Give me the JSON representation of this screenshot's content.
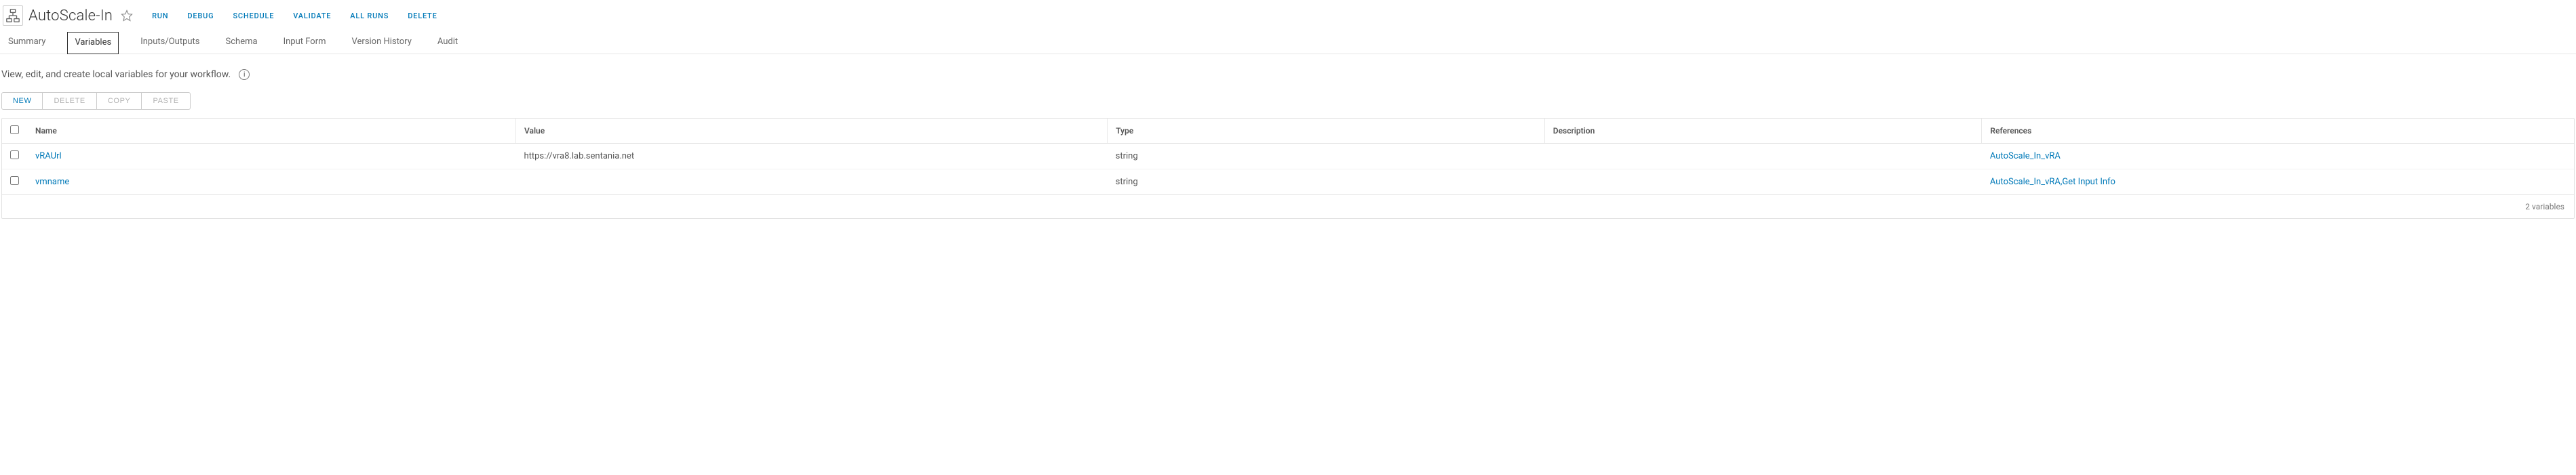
{
  "header": {
    "title": "AutoScale-In",
    "actions": {
      "run": "RUN",
      "debug": "DEBUG",
      "schedule": "SCHEDULE",
      "validate": "VALIDATE",
      "all_runs": "ALL RUNS",
      "delete": "DELETE"
    }
  },
  "tabs": {
    "summary": "Summary",
    "variables": "Variables",
    "inputs_outputs": "Inputs/Outputs",
    "schema": "Schema",
    "input_form": "Input Form",
    "version_history": "Version History",
    "audit": "Audit"
  },
  "description": "View, edit, and create local variables for your workflow.",
  "toolbar": {
    "new": "NEW",
    "delete": "DELETE",
    "copy": "COPY",
    "paste": "PASTE"
  },
  "table": {
    "columns": {
      "name": "Name",
      "value": "Value",
      "type": "Type",
      "description": "Description",
      "references": "References"
    },
    "rows": [
      {
        "name": "vRAUrl",
        "value": "https://vra8.lab.sentania.net",
        "type": "string",
        "description": "",
        "references": "AutoScale_In_vRA"
      },
      {
        "name": "vmname",
        "value": "",
        "type": "string",
        "description": "",
        "references": "AutoScale_In_vRA,Get Input Info"
      }
    ],
    "footer": "2 variables"
  }
}
